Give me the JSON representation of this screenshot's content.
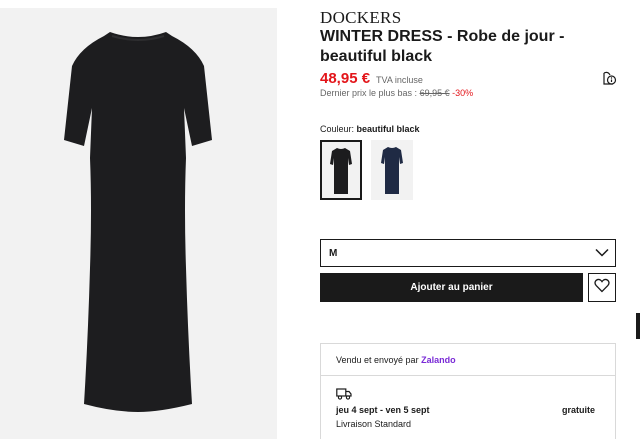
{
  "product": {
    "brand": "DOCKERS",
    "title": "WINTER DRESS - Robe de jour - beautiful black",
    "price": "48,95 €",
    "tva": "TVA incluse",
    "last_price_label": "Dernier prix le plus bas :",
    "last_price_old": "69,95 €",
    "last_price_discount": "-30%"
  },
  "color": {
    "label": "Couleur:",
    "selected": "beautiful black",
    "swatches": [
      {
        "name": "beautiful black",
        "hex": "#1c1c1e"
      },
      {
        "name": "navy",
        "hex": "#1f2a44"
      }
    ]
  },
  "size": {
    "selected": "M"
  },
  "actions": {
    "add_to_cart": "Ajouter au panier"
  },
  "delivery": {
    "seller_prefix": "Vendu et envoyé par",
    "seller_name": "Zalando",
    "dates": "jeu 4 sept - ven 5 sept",
    "price": "gratuite",
    "method": "Livraison Standard"
  },
  "colors": {
    "accent_red": "#e3151a",
    "zalando_purple": "#7a2bd6"
  },
  "icons": [
    "info-icon",
    "chevron-down-icon",
    "heart-icon",
    "truck-icon"
  ]
}
